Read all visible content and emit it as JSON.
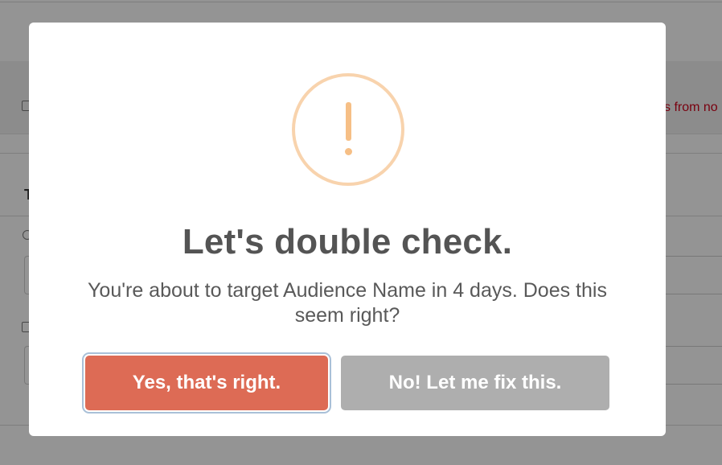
{
  "background": {
    "banner_text": "s from no",
    "fragment_letter": "T"
  },
  "modal": {
    "icon": "warning-exclamation-icon",
    "icon_color": "#f8bb86",
    "title": "Let's double check.",
    "message": "You're about to target Audience Name in 4 days. Does this seem right?",
    "confirm_label": "Yes, that's right.",
    "confirm_color": "#dd6b55",
    "cancel_label": "No! Let me fix this.",
    "cancel_color": "#aeaeae"
  }
}
